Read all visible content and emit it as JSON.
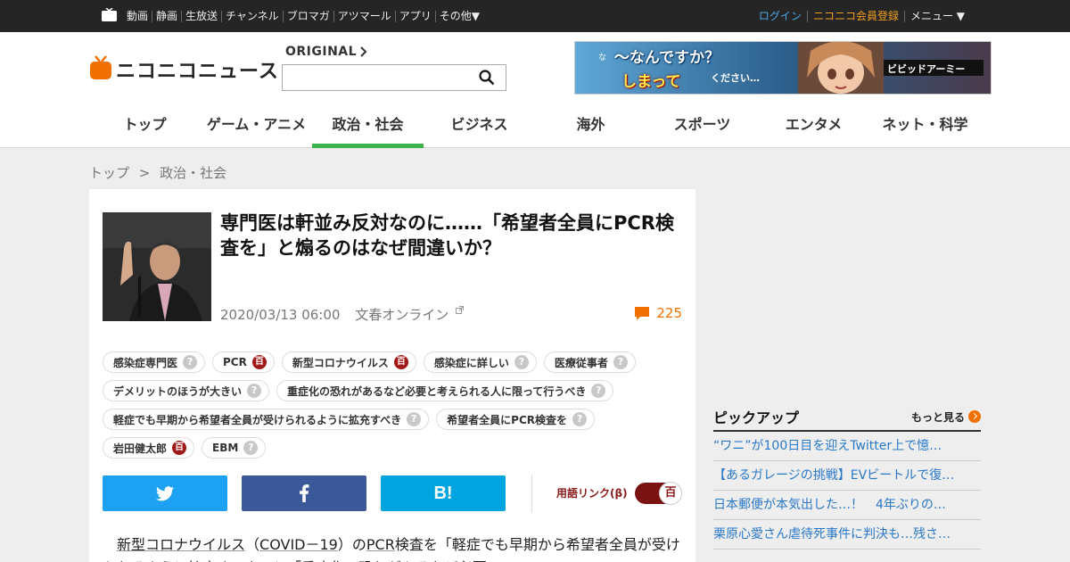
{
  "topbar": {
    "nav": [
      "動画",
      "静画",
      "生放送",
      "チャンネル",
      "ブロマガ",
      "アツマール",
      "アプリ",
      "その他▼"
    ],
    "login": "ログイン",
    "register": "ニコニコ会員登録",
    "menu": "メニュー ▼"
  },
  "header": {
    "logo_text": "ニコニコニュース",
    "original_label": "ORIGINAL",
    "search_value": "",
    "banner": {
      "pre": "な",
      "line1": "〜なんですか？",
      "line2": "しまって",
      "line3": "ください…",
      "logo": "ビビッドアーミー"
    }
  },
  "categories": [
    {
      "label": "トップ",
      "active": false
    },
    {
      "label": "ゲーム・アニメ",
      "active": false
    },
    {
      "label": "政治・社会",
      "active": true
    },
    {
      "label": "ビジネス",
      "active": false
    },
    {
      "label": "海外",
      "active": false
    },
    {
      "label": "スポーツ",
      "active": false
    },
    {
      "label": "エンタメ",
      "active": false
    },
    {
      "label": "ネット・科学",
      "active": false
    }
  ],
  "breadcrumb": {
    "home": "トップ",
    "sep": ">",
    "current": "政治・社会"
  },
  "article": {
    "title": "専門医は軒並み反対なのに……「希望者全員にPCR検査を」と煽るのはなぜ間違いか？",
    "date": "2020/03/13 06:00",
    "source": "文春オンライン",
    "comment_count": "225",
    "tags": [
      {
        "label": "感染症専門医",
        "mark": "q"
      },
      {
        "label": "PCR",
        "mark": "h"
      },
      {
        "label": "新型コロナウイルス",
        "mark": "h"
      },
      {
        "label": "感染症に詳しい",
        "mark": "q"
      },
      {
        "label": "医療従事者",
        "mark": "q"
      },
      {
        "label": "デメリットのほうが大きい",
        "mark": "q"
      },
      {
        "label": "重症化の恐れがあるなど必要と考えられる人に限って行うべき",
        "mark": "q"
      },
      {
        "label": "軽症でも早期から希望者全員が受けられるように拡充すべき",
        "mark": "q"
      },
      {
        "label": "希望者全員にPCR検査を",
        "mark": "q"
      },
      {
        "label": "岩田健太郎",
        "mark": "h"
      },
      {
        "label": "EBM",
        "mark": "q"
      }
    ],
    "term_link_label": "用語リンク(β)",
    "toggle_mark": "百",
    "share_hatena": "B!",
    "body": {
      "u1": "新型コロナウイルス",
      "p1": "（",
      "u2": "COVID－19",
      "p2": "）の",
      "u3": "PCR",
      "p3": "検査を「軽症でも早期から希望者全員が受けられるように拡充すべき」と「重症化の恐れがあるなど必要"
    }
  },
  "pickup": {
    "title": "ピックアップ",
    "more": "もっと見る",
    "items": [
      "“ワニ”が100日目を迎えTwitter上で憶…",
      "【あるガレージの挑戦】EVビートルで復…",
      "日本郵便が本気出した…！　4年ぶりの…",
      "栗原心愛さん虐待死事件に判決も…残さ…"
    ]
  },
  "colors": {
    "topbar": "#252525",
    "accent_green": "#3cb44b",
    "comment_orange": "#f07000",
    "twitter": "#1da1f2",
    "facebook": "#3b5998",
    "hatena": "#00a4de",
    "link_blue": "#2a78c8"
  }
}
